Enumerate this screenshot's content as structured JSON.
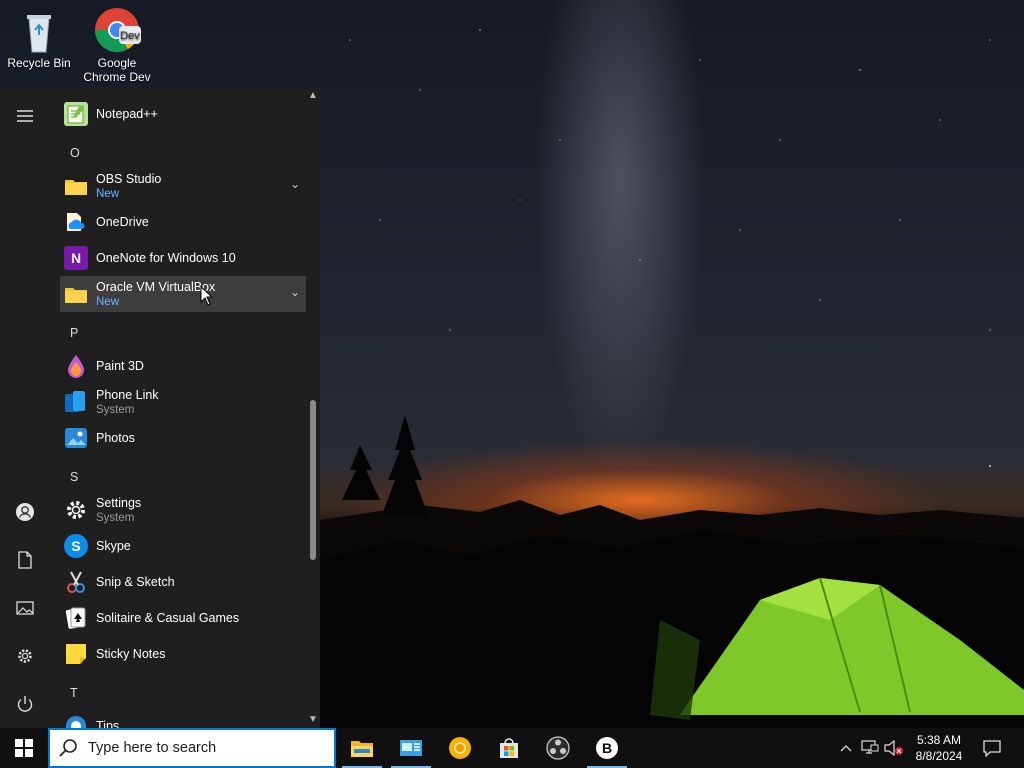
{
  "desktop": {
    "icons": [
      {
        "label": "Recycle Bin",
        "icon": "recycle-bin-icon"
      },
      {
        "label": "Google Chrome Dev",
        "icon": "chrome-dev-icon",
        "badge": "Dev"
      }
    ]
  },
  "start_menu": {
    "rail": [
      {
        "icon": "hamburger-menu-icon"
      },
      {
        "icon": "user-account-icon"
      },
      {
        "icon": "documents-icon"
      },
      {
        "icon": "pictures-icon"
      },
      {
        "icon": "settings-gear-icon"
      },
      {
        "icon": "power-icon"
      }
    ],
    "apps": [
      {
        "type": "app",
        "name": "Notepad++",
        "icon": "notepadpp-icon"
      },
      {
        "type": "letter",
        "name": "O"
      },
      {
        "type": "app",
        "name": "OBS Studio",
        "sub": "New",
        "icon": "folder-icon",
        "expandable": true
      },
      {
        "type": "app",
        "name": "OneDrive",
        "icon": "onedrive-icon"
      },
      {
        "type": "app",
        "name": "OneNote for Windows 10",
        "icon": "onenote-icon",
        "badge": "N"
      },
      {
        "type": "app",
        "name": "Oracle VM VirtualBox",
        "sub": "New",
        "icon": "folder-icon",
        "expandable": true,
        "hover": true
      },
      {
        "type": "letter",
        "name": "P"
      },
      {
        "type": "app",
        "name": "Paint 3D",
        "icon": "paint3d-icon"
      },
      {
        "type": "app",
        "name": "Phone Link",
        "sub": "System",
        "icon": "phone-link-icon"
      },
      {
        "type": "app",
        "name": "Photos",
        "icon": "photos-icon"
      },
      {
        "type": "letter",
        "name": "S"
      },
      {
        "type": "app",
        "name": "Settings",
        "sub": "System",
        "icon": "settings-icon"
      },
      {
        "type": "app",
        "name": "Skype",
        "icon": "skype-icon",
        "badge": "S"
      },
      {
        "type": "app",
        "name": "Snip & Sketch",
        "icon": "snip-sketch-icon"
      },
      {
        "type": "app",
        "name": "Solitaire & Casual Games",
        "icon": "solitaire-icon"
      },
      {
        "type": "app",
        "name": "Sticky Notes",
        "icon": "sticky-notes-icon"
      },
      {
        "type": "letter",
        "name": "T"
      },
      {
        "type": "app",
        "name": "Tips",
        "icon": "tips-icon"
      }
    ]
  },
  "taskbar": {
    "search_placeholder": "Type here to search",
    "pinned": [
      {
        "icon": "file-explorer-icon",
        "active": true
      },
      {
        "icon": "control-panel-icon",
        "active": true
      },
      {
        "icon": "canary-browser-icon",
        "active": false
      },
      {
        "icon": "microsoft-store-icon",
        "active": false
      },
      {
        "icon": "obs-studio-icon",
        "active": false
      },
      {
        "icon": "b-app-icon",
        "badge": "B",
        "active": true
      }
    ],
    "tray": {
      "icons": [
        "show-hidden-icons-chevron",
        "network-icon",
        "volume-muted-icon",
        "notifications-icon"
      ],
      "time": "5:38 AM",
      "date": "8/8/2024"
    }
  },
  "colors": {
    "accent": "#0078d4",
    "new_label": "#6bb6ff",
    "menu_bg": "#1f1f1f",
    "hover_bg": "#3d3d3d"
  }
}
